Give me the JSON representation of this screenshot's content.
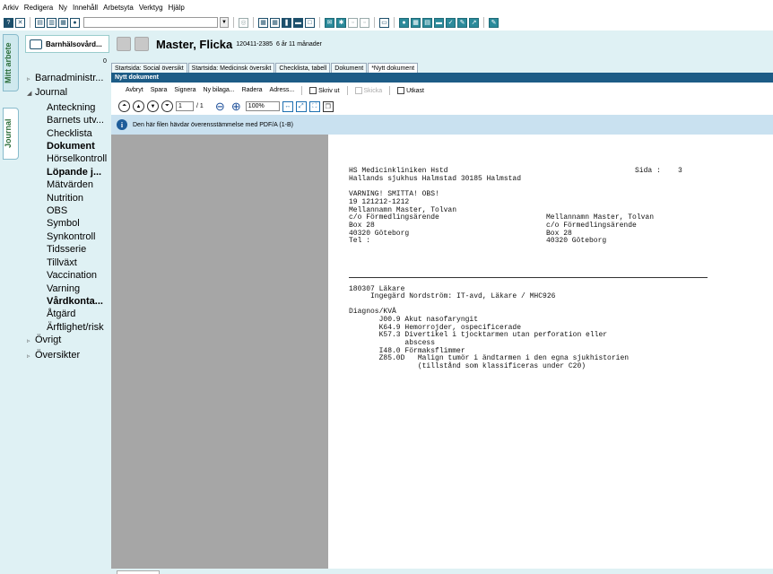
{
  "menu": [
    "Arkiv",
    "Redigera",
    "Ny",
    "Innehåll",
    "Arbetsyta",
    "Verktyg",
    "Hjälp"
  ],
  "vertical_tabs": [
    "Mitt arbete",
    "Journal"
  ],
  "unit": {
    "name": "Barnhälsovård...",
    "badge": "0"
  },
  "tree": [
    {
      "label": "Barnadministr...",
      "level": 0,
      "arrow": "▹",
      "bold": false
    },
    {
      "label": "Journal",
      "level": 0,
      "arrow": "◢",
      "bold": false
    },
    {
      "label": "Anteckning",
      "level": 1,
      "bold": false
    },
    {
      "label": "Barnets utv...",
      "level": 1,
      "bold": false
    },
    {
      "label": "Checklista",
      "level": 1,
      "bold": false
    },
    {
      "label": "Dokument",
      "level": 1,
      "bold": true
    },
    {
      "label": "Hörselkontroll",
      "level": 1,
      "bold": false
    },
    {
      "label": "Löpande j...",
      "level": 1,
      "bold": true
    },
    {
      "label": "Mätvärden",
      "level": 1,
      "bold": false
    },
    {
      "label": "Nutrition",
      "level": 1,
      "bold": false
    },
    {
      "label": "OBS",
      "level": 1,
      "bold": false
    },
    {
      "label": "Symbol",
      "level": 1,
      "bold": false
    },
    {
      "label": "Synkontroll",
      "level": 1,
      "bold": false
    },
    {
      "label": "Tidsserie",
      "level": 1,
      "bold": false
    },
    {
      "label": "Tillväxt",
      "level": 1,
      "bold": false
    },
    {
      "label": "Vaccination",
      "level": 1,
      "bold": false
    },
    {
      "label": "Varning",
      "level": 1,
      "bold": false
    },
    {
      "label": "Vårdkonta...",
      "level": 1,
      "bold": true
    },
    {
      "label": "Åtgärd",
      "level": 1,
      "bold": false
    },
    {
      "label": "Ärftlighet/risk",
      "level": 1,
      "bold": false
    },
    {
      "label": "Övrigt",
      "level": 0,
      "arrow": "▹",
      "bold": false
    },
    {
      "label": "Översikter",
      "level": 0,
      "arrow": "▹",
      "bold": false
    }
  ],
  "patient": {
    "name": "Master, Flicka",
    "id": "120411-2385",
    "age": "6 år 11 månader"
  },
  "tabs": [
    {
      "label": "Startsida: Social översikt",
      "active": false
    },
    {
      "label": "Startsida: Medicinsk översikt",
      "active": false
    },
    {
      "label": "Checklista, tabell",
      "active": false
    },
    {
      "label": "Dokument",
      "active": false
    },
    {
      "label": "*Nytt dokument",
      "active": true
    }
  ],
  "doc_header": "Nytt dokument",
  "doc_toolbar": {
    "avbryt": "Avbryt",
    "spara": "Spara",
    "signera": "Signera",
    "ny_bilaga": "Ny bilaga...",
    "radera": "Radera",
    "adress": "Adress...",
    "skriv_ut": "Skriv ut",
    "skicka": "Skicka",
    "utkast": "Utkast"
  },
  "pdf_toolbar": {
    "page": "1",
    "total": "/ 1",
    "zoom": "100%"
  },
  "info_text": "Den här filen hävdar överensstämmelse med PDF/A (1-B)",
  "document": {
    "clinic1": "HS Medicinkliniken Hstd",
    "clinic2": "Hallands sjukhus Halmstad 30185 Halmstad",
    "page_label": "Sida :    3",
    "warning": "VARNING! SMITTA! OBS!",
    "pnr": "19 121212-1212",
    "name1": "Mellannamn Master, Tolvan",
    "co1": "c/o Förmedlingsärende",
    "box1": "Box 28",
    "city1": "40320 Göteborg",
    "tel": "Tel :",
    "name2": "Mellannamn Master, Tolvan",
    "co2": "c/o Förmedlingsärende",
    "box2": "Box 28",
    "city2": "40320 Göteborg",
    "date_role": "180307 Läkare",
    "author": "     Ingegärd Nordström: IT-avd, Läkare / MHC926",
    "diag_header": "Diagnos/KVÅ",
    "diagnoses": [
      "       J00.9 Akut nasofaryngit",
      "       K64.9 Hemorrojder, ospecificerade",
      "       K57.3 Divertikel i tjocktarmen utan perforation eller",
      "             abscess",
      "       I48.0 Förmaksflimmer",
      "       Z85.0D   Malign tumör i ändtarmen i den egna sjukhistorien",
      "                (tillstånd som klassificeras under C20)"
    ]
  }
}
